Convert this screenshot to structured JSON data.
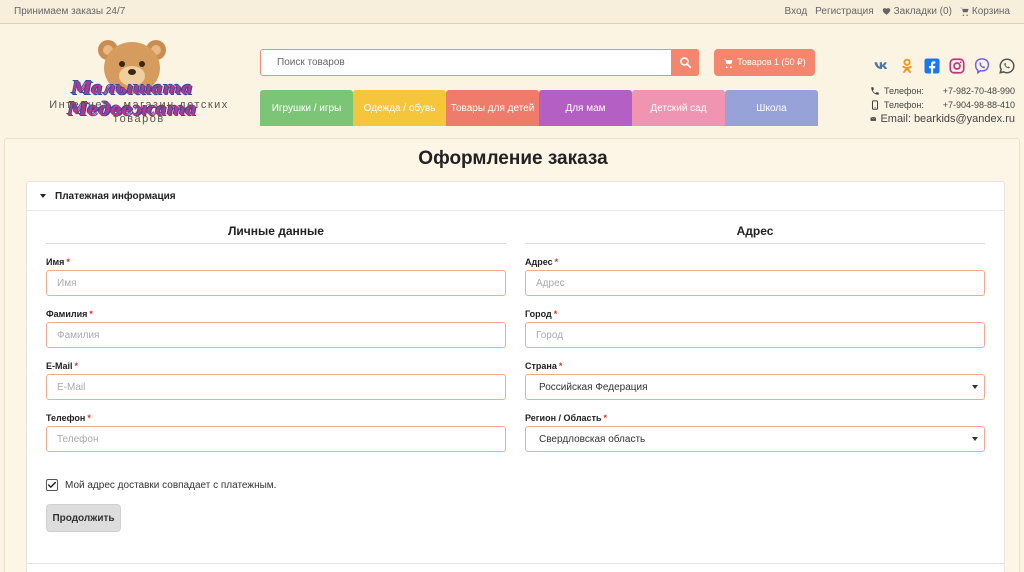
{
  "topbar": {
    "tagline": "Принимаем заказы 24/7",
    "login": "Вход",
    "register": "Регистрация",
    "bookmarks": "Закладки (0)",
    "cart": "Корзина"
  },
  "logo": {
    "title": "Малышата Медвежата",
    "subtitle": "Интернет - магазин детских товаров"
  },
  "search": {
    "placeholder": "Поиск товаров"
  },
  "cart_button": {
    "label": "Товаров 1 (50 ₽)"
  },
  "menu": [
    {
      "label": "Игрушки / игры",
      "color": "#7cc576"
    },
    {
      "label": "Одежда / обувь",
      "color": "#f5c63c"
    },
    {
      "label": "Товары для детей",
      "color": "#ef7b6b"
    },
    {
      "label": "Для мам",
      "color": "#b45fc4"
    },
    {
      "label": "Детский сад",
      "color": "#ef95b2"
    },
    {
      "label": "Школа",
      "color": "#97a3d8"
    }
  ],
  "social": [
    "vk-icon",
    "odnoklassniki-icon",
    "facebook-icon",
    "instagram-icon",
    "viber-icon",
    "whatsapp-icon"
  ],
  "contacts": {
    "phone1_label": "Телефон:",
    "phone1": "+7-982-70-48-990",
    "phone2_label": "Телефон:",
    "phone2": "+7-904-98-88-410",
    "email_label": "Email:",
    "email": "bearkids@yandex.ru"
  },
  "page": {
    "title": "Оформление заказа"
  },
  "panel": {
    "heading": "Платежная информация",
    "personal": {
      "title": "Личные данные",
      "first_name_label": "Имя",
      "first_name_placeholder": "Имя",
      "last_name_label": "Фамилия",
      "last_name_placeholder": "Фамилия",
      "email_label": "E-Mail",
      "email_placeholder": "E-Mail",
      "phone_label": "Телефон",
      "phone_placeholder": "Телефон"
    },
    "address": {
      "title": "Адрес",
      "address_label": "Адрес",
      "address_placeholder": "Адрес",
      "city_label": "Город",
      "city_placeholder": "Город",
      "country_label": "Страна",
      "country_value": "Российская Федерация",
      "region_label": "Регион / Область",
      "region_value": "Свердловская область"
    },
    "same_address_label": "Мой адрес доставки совпадает с платежным.",
    "same_address_checked": true,
    "continue_label": "Продолжить"
  }
}
